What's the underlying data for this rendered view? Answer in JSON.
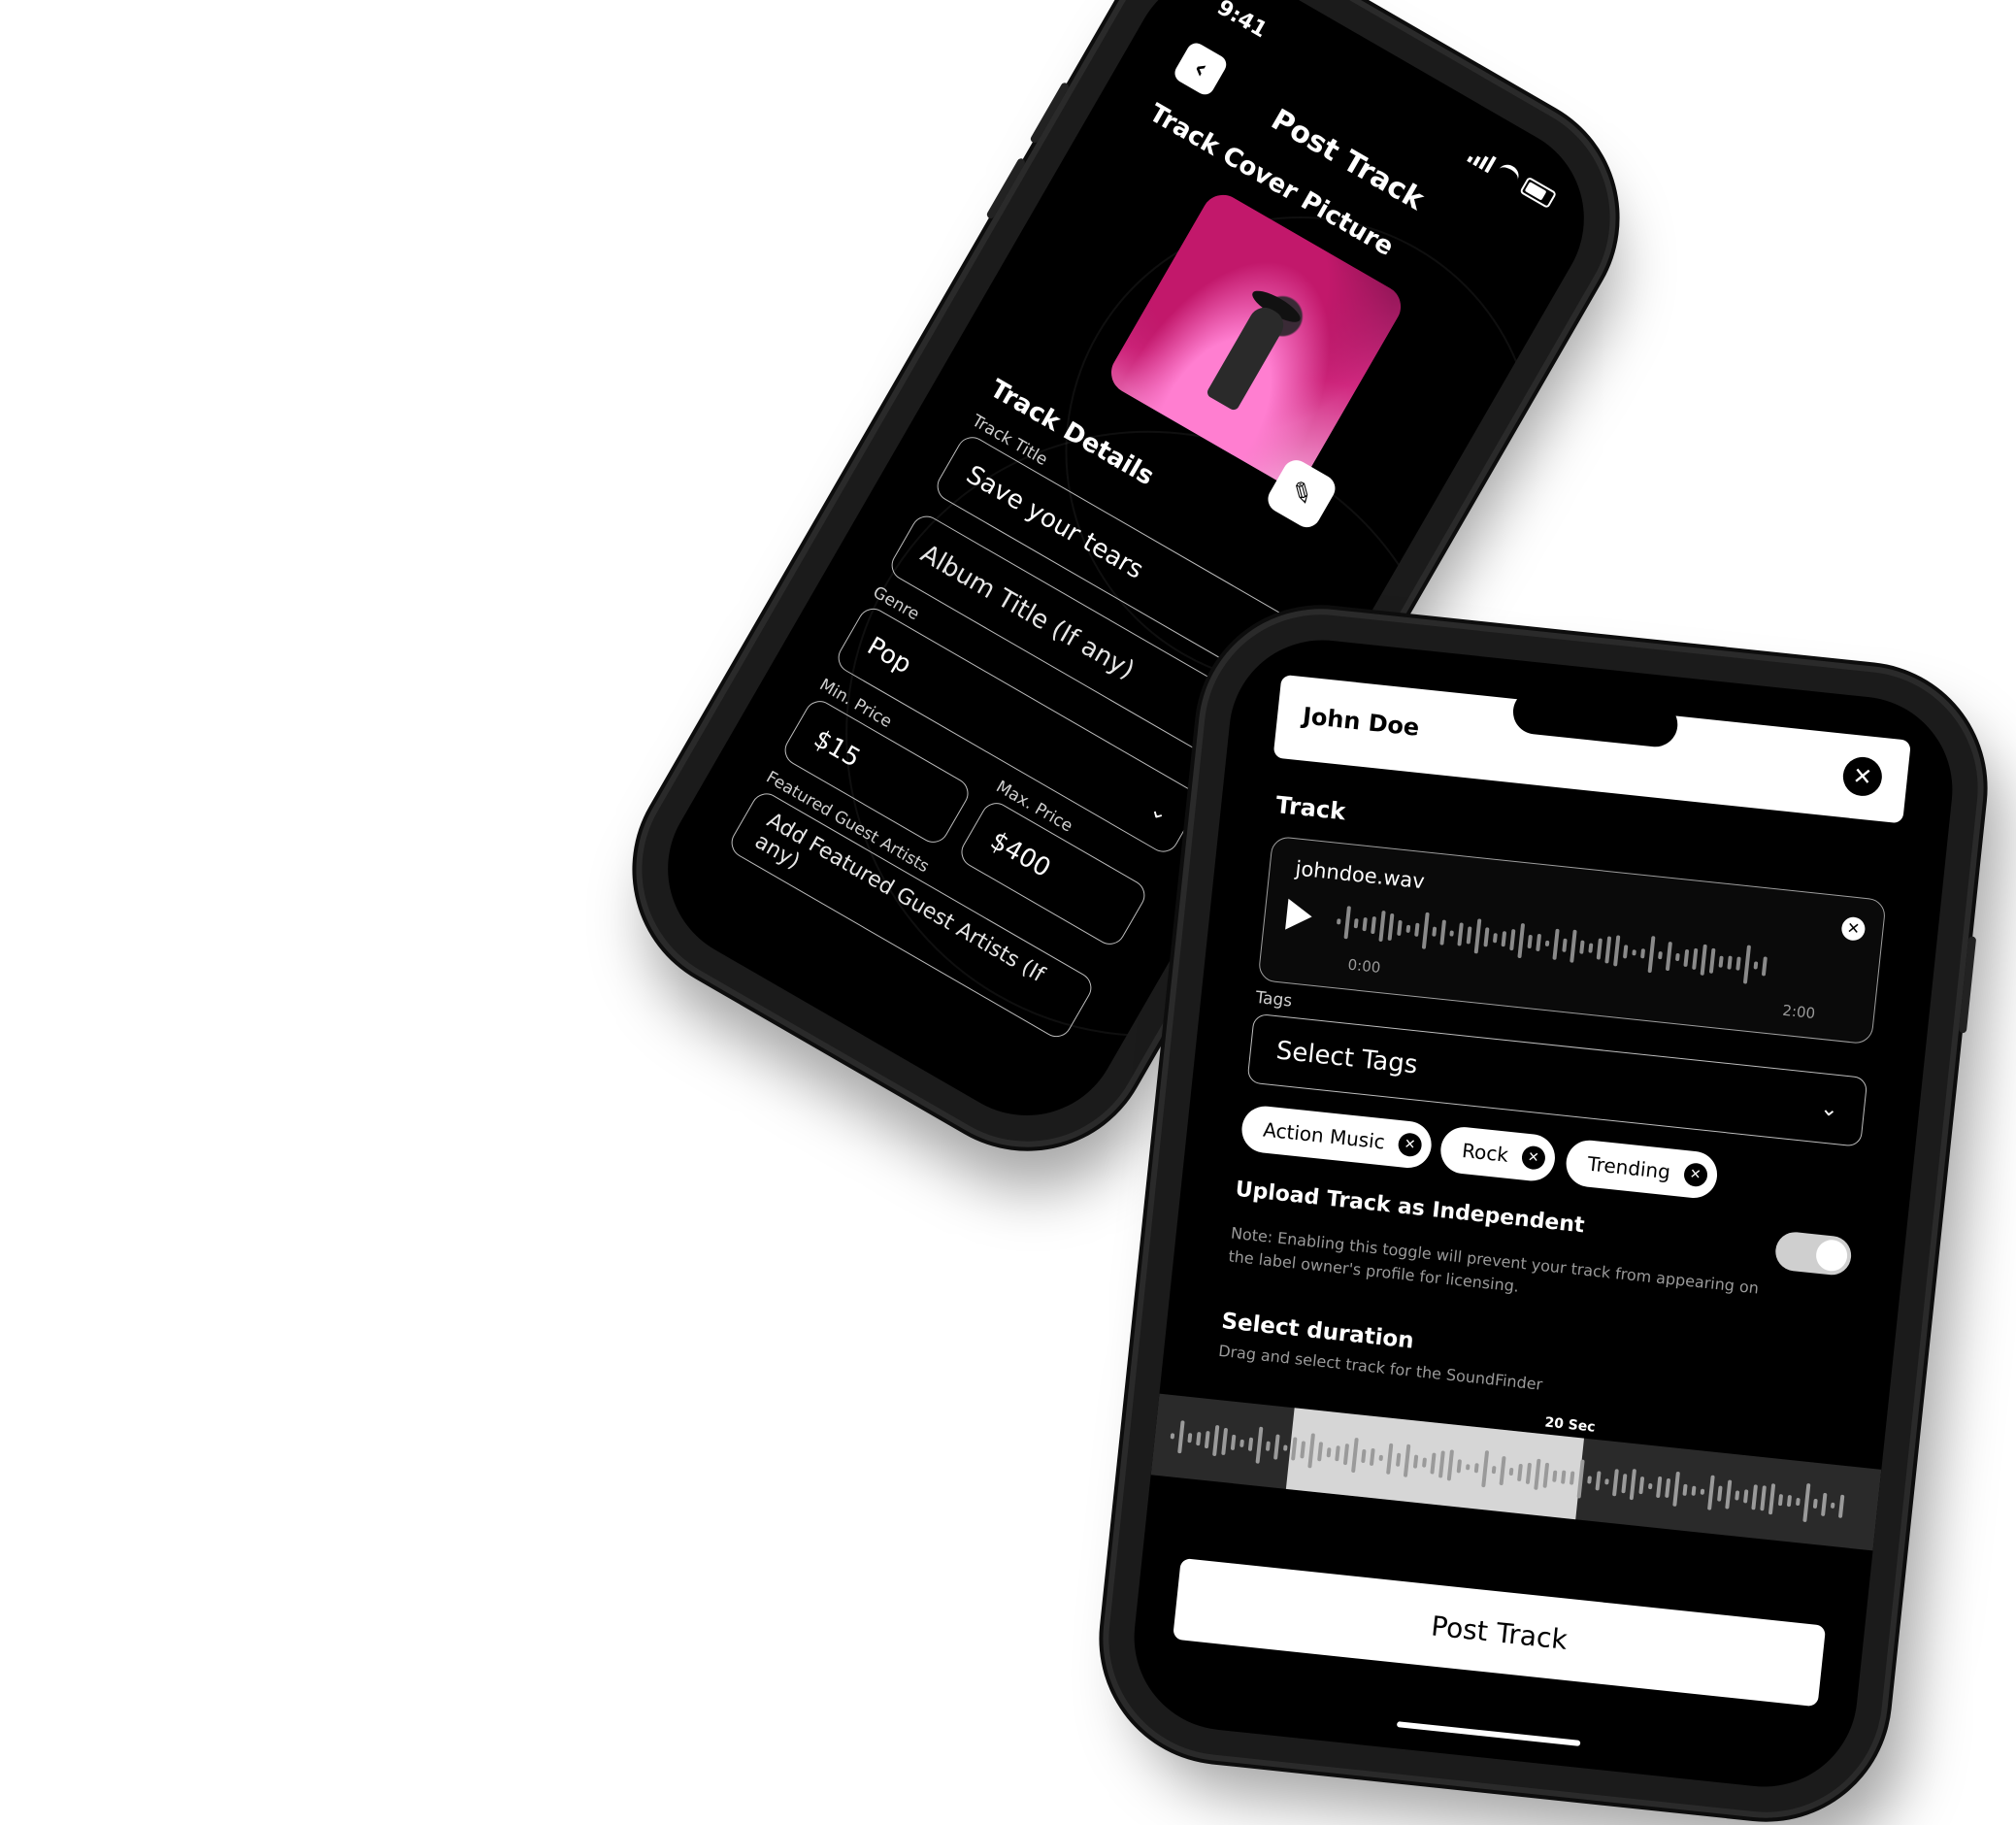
{
  "post_screen": {
    "status_time": "9:41",
    "title": "Post Track",
    "cover_section": "Track Cover Picture",
    "details_section": "Track Details",
    "track_title_label": "Track Title",
    "track_title_value": "Save your tears",
    "album_placeholder": "Album Title (If any)",
    "genre_label": "Genre",
    "genre_value": "Pop",
    "min_price_label": "Min. Price",
    "min_price_value": "$15",
    "max_price_label": "Max. Price",
    "max_price_value": "$400",
    "guest_label": "Featured Guest Artists",
    "guest_placeholder": "Add Featured Guest Artists (If any)"
  },
  "upload_screen": {
    "user_name": "John Doe",
    "track_label": "Track",
    "file_name": "johndoe.wav",
    "time_start": "0:00",
    "time_end": "2:00",
    "tags_label": "Tags",
    "tags_placeholder": "Select Tags",
    "chips": [
      "Action Music",
      "Rock",
      "Trending"
    ],
    "independent_label": "Upload Track as Independent",
    "independent_on": true,
    "note": "Note: Enabling this toggle will prevent your track from appearing on the label owner's profile for licensing.",
    "duration_title": "Select duration",
    "duration_sub": "Drag and select track for the SoundFinder",
    "duration_badge": "20 Sec",
    "post_button": "Post Track"
  },
  "icons": {
    "back": "chevron-left-icon",
    "edit": "pencil-icon",
    "close": "close-icon",
    "play": "play-icon",
    "dropdown": "chevron-down-icon"
  }
}
